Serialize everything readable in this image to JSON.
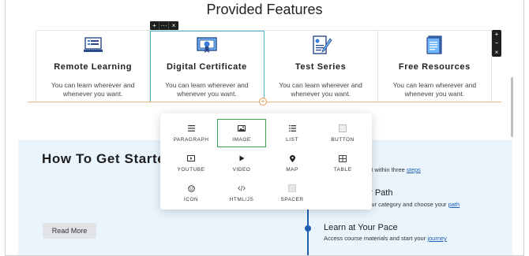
{
  "section": {
    "title": "Provided Features"
  },
  "mini_toolbar": {
    "items": [
      "+",
      "···",
      "×"
    ]
  },
  "side_tools": {
    "items": [
      "+",
      "−",
      "×"
    ]
  },
  "features": [
    {
      "title": "Remote Learning",
      "desc": "You can learn wherever and whenever you want.",
      "icon": "computer-icon"
    },
    {
      "title": "Digital Certificate",
      "desc": "You can learn wherever and whenever you want.",
      "icon": "certificate-icon"
    },
    {
      "title": "Test Series",
      "desc": "You can learn wherever and whenever you want.",
      "icon": "test-paper-icon"
    },
    {
      "title": "Free Resources",
      "desc": "You can learn wherever and whenever you want.",
      "icon": "document-icon"
    }
  ],
  "add_button": "+",
  "block_menu": {
    "items": [
      {
        "label": "PARAGRAPH",
        "icon": "paragraph-icon",
        "active": false
      },
      {
        "label": "IMAGE",
        "icon": "image-icon",
        "active": true
      },
      {
        "label": "LIST",
        "icon": "list-icon",
        "active": false
      },
      {
        "label": "BUTTON",
        "icon": "button-icon",
        "active": false
      },
      {
        "label": "YOUTUBE",
        "icon": "youtube-icon",
        "active": false
      },
      {
        "label": "VIDEO",
        "icon": "play-icon",
        "active": false
      },
      {
        "label": "MAP",
        "icon": "map-pin-icon",
        "active": false
      },
      {
        "label": "TABLE",
        "icon": "table-icon",
        "active": false
      },
      {
        "label": "ICON",
        "icon": "smiley-icon",
        "active": false
      },
      {
        "label": "HTML/JS",
        "icon": "code-icon",
        "active": false
      },
      {
        "label": "SPACER",
        "icon": "spacer-icon",
        "active": false
      }
    ]
  },
  "how_to": {
    "title": "How To Get Starte",
    "read_more": "Read More",
    "step1": {
      "text_prefix": "count within three ",
      "link": "steps"
    },
    "step2": {
      "title": "ur Path",
      "text_prefix": "n our category and choose your ",
      "link": "path"
    },
    "step3": {
      "title": "Learn at Your Pace",
      "text_prefix": "Access course materials and start your ",
      "link": "journey"
    }
  },
  "colors": {
    "accent_blue": "#1e5fb5",
    "selected_green": "#3aa14e",
    "selection_outline": "#4fb3c9",
    "lower_bg": "#eaf4fc"
  }
}
